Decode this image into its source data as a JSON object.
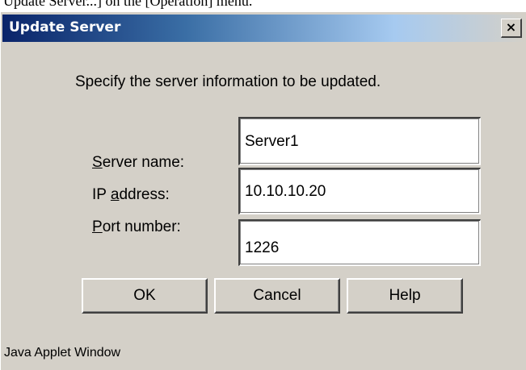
{
  "top_cut_text": "Update Server...] on the [Operation] menu.",
  "window": {
    "title": "Update Server",
    "close_glyph": "×"
  },
  "instruction": "Specify the server information to be updated.",
  "fields": {
    "server_name": {
      "label_mnemonic": "S",
      "label_rest": "erver name:",
      "value": "Server1"
    },
    "ip_address": {
      "label_pre": "IP ",
      "label_mnemonic": "a",
      "label_rest": "ddress:",
      "value": "10.10.10.20"
    },
    "port_number": {
      "label_mnemonic": "P",
      "label_rest": "ort number:",
      "value": "1226"
    }
  },
  "buttons": {
    "ok": "OK",
    "cancel": "Cancel",
    "help": "Help"
  },
  "status": "Java Applet Window",
  "colors": {
    "dialog_bg": "#d4d0c8",
    "titlebar_start": "#0a246a",
    "titlebar_end": "#a6caf0",
    "title_text": "#ffffff"
  }
}
